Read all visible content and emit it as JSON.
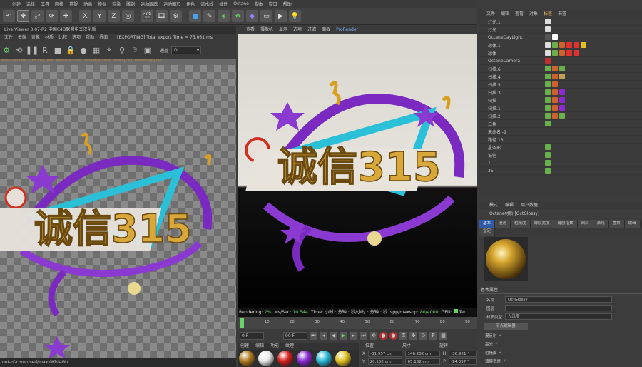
{
  "menubar": [
    "创建",
    "选择",
    "工具",
    "网格",
    "捕捉",
    "动画",
    "模拟",
    "渲染",
    "雕刻",
    "运动跟踪",
    "运动图形",
    "角色",
    "流水线",
    "插件",
    "Octane",
    "脚本",
    "窗口",
    "帮助"
  ],
  "toolbar": {
    "axes": [
      "X",
      "Y",
      "Z"
    ]
  },
  "live_viewer": {
    "title": "Live Viewer 3.07-R2 中国C4D联盟中文汉化版",
    "menu": [
      "文件",
      "云端",
      "对象",
      "材质",
      "比较",
      "选项",
      "帮助",
      "界面"
    ],
    "export_text": "[EXPORTING] Total export Time = 75.061 ms",
    "channel_label": "通道",
    "channel_value": "DL",
    "status": "MeshGen:0ms, Upd.Img:0ms, MeshGen:0ms, Update[M]:0ms, Nodes[283] Movable[8] 0/0",
    "memory": "out-of-core used/max:0Kb/4Gb"
  },
  "viewport": {
    "menu": [
      "查看",
      "摄像机",
      "显示",
      "选项",
      "过滤",
      "面板",
      "ProRender"
    ],
    "render_label": "Rendering:",
    "render_pct": "2%",
    "ms_label": "Ms/Sec:",
    "ms_value": "10.544",
    "time_text": "Time: 小时 : 分钟 : 秒/小时 : 分钟 : 秒",
    "spp_label": "spp/maxspp:",
    "spp_value": "80/4000",
    "gpu_text": "GPU:",
    "tail": "Ter",
    "scene_text": "诚信315"
  },
  "timeline": {
    "ticks": [
      "0",
      "10",
      "20",
      "30",
      "40",
      "50",
      "60",
      "70",
      "80",
      "90"
    ],
    "start": "0 F",
    "end": "90 F"
  },
  "materials": {
    "tabs": [
      "创建",
      "编辑",
      "功能",
      "纹理"
    ],
    "swatches": [
      "#b07a1e",
      "#e8e8e8",
      "#d42020",
      "#8a2ad0",
      "#2ab8d8",
      "#e0c020"
    ]
  },
  "coordinates": {
    "headers": [
      "位置",
      "尺寸",
      "旋转"
    ],
    "rows": [
      {
        "axis": "X",
        "pos": "-31.957 cm",
        "size": "146.202 cm",
        "rot_axis": "H",
        "rot": "-36.921 °"
      },
      {
        "axis": "Y",
        "pos": "20.152 cm",
        "size": "65.162 cm",
        "rot_axis": "P",
        "rot": "-14.337 °"
      }
    ]
  },
  "object_manager": {
    "menu": [
      "文件",
      "编辑",
      "查看",
      "对象",
      "标签",
      "书签"
    ],
    "rows": [
      {
        "name": "灯光.1",
        "tags": [
          "#dddddd"
        ]
      },
      {
        "name": "灯光",
        "tags": [
          "#dddddd"
        ]
      },
      {
        "name": "OctaneDayLight",
        "tags": [
          "#555",
          "#ffffff"
        ]
      },
      {
        "name": "球体.1",
        "tags": [
          "#dddddd",
          "#6ab04a",
          "#d06030",
          "#e03030",
          "#e03030",
          "#e0c020"
        ]
      },
      {
        "name": "球体",
        "tags": [
          "#dddddd",
          "#6ab04a",
          "#d06030",
          "#e03030",
          "#e03030"
        ]
      },
      {
        "name": "OctaneCamera",
        "tags": [
          "#c03030"
        ]
      },
      {
        "name": "扫描.6",
        "tags": [
          "#6ab04a",
          "#d06030",
          "#6ab04a"
        ]
      },
      {
        "name": "扫描.4",
        "tags": [
          "#6ab04a",
          "#d06030",
          "#c0a050"
        ]
      },
      {
        "name": "扫描.5",
        "tags": [
          "#6ab04a",
          "#d06030"
        ]
      },
      {
        "name": "扫描.3",
        "tags": [
          "#6ab04a",
          "#d06030",
          "#8a2ad0"
        ]
      },
      {
        "name": "扫描",
        "tags": [
          "#6ab04a",
          "#d06030",
          "#8a2ad0"
        ]
      },
      {
        "name": "扫描.1",
        "tags": [
          "#6ab04a",
          "#d06030",
          "#8a2ad0"
        ]
      },
      {
        "name": "扫描.2",
        "tags": [
          "#6ab04a",
          "#d06030",
          "#6ab04a"
        ]
      },
      {
        "name": "三角",
        "tags": [
          "#6ab04a"
        ]
      },
      {
        "name": "未命名 -1",
        "tags": []
      },
      {
        "name": "路径 13",
        "tags": []
      },
      {
        "name": "星条形",
        "tags": [
          "#6ab04a"
        ]
      },
      {
        "name": "诚信",
        "tags": [
          "#6ab04a"
        ]
      },
      {
        "name": "1",
        "tags": [
          "#6ab04a"
        ]
      },
      {
        "name": "35",
        "tags": [
          "#6ab04a"
        ]
      }
    ]
  },
  "attributes": {
    "menu": [
      "模式",
      "编辑",
      "用户数据"
    ],
    "title": "Octane材质 [OctGlossy]",
    "tabs": [
      "基本",
      "漫光",
      "粗糙度",
      "薄膜宽度",
      "薄膜指数",
      "凹凸",
      "法线",
      "置换",
      "编辑",
      "指定"
    ],
    "section": "基本属性",
    "name_label": "名称",
    "name_value": "OctGlossy",
    "layer_label": "图层",
    "type_label": "材质类型",
    "type_value": "光泽度",
    "node_editor": "节点编辑器",
    "checks": [
      "漫反射",
      "高光",
      "粗糙度",
      "薄膜宽度"
    ]
  }
}
